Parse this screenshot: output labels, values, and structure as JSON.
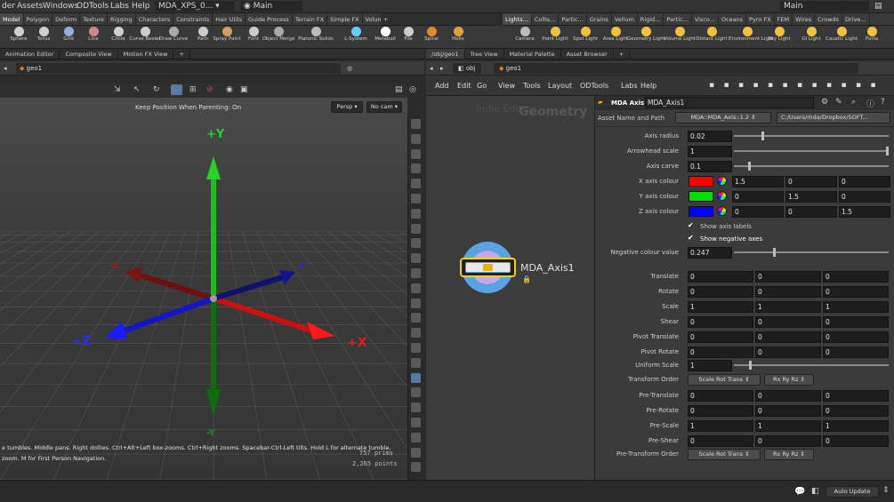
{
  "menubar": {
    "items": [
      "der",
      "Assets",
      "Windows",
      "ODTools",
      "Labs",
      "Help"
    ],
    "desktop": "MDA_XPS_0...",
    "context": "Main",
    "right_context": "Main"
  },
  "shelf_tabs_left": [
    "Model",
    "Polygon",
    "Deform",
    "Texture",
    "Rigging",
    "Characters",
    "Constraints",
    "Hair Utils",
    "Guide Process",
    "Terrain FX",
    "Simple FX",
    "Volume"
  ],
  "shelf_tabs_right": [
    "Lights...",
    "Collis...",
    "Partic...",
    "Grains",
    "Vellum",
    "Rigid...",
    "Partic...",
    "Visco...",
    "Oceans",
    "Pyro FX",
    "FEM",
    "Wires",
    "Crowds",
    "Drive..."
  ],
  "tools_left": [
    "Sphere",
    "Torus",
    "Grid",
    "Line",
    "Circle",
    "Curve Bezier",
    "Draw Curve",
    "Path",
    "Spray Paint",
    "Font",
    "Object Merge",
    "Platonic Solids",
    "L-System",
    "Metaball",
    "File",
    "Spiral",
    "Helix"
  ],
  "tools_right": [
    "Camera",
    "Point Light",
    "Spot Light",
    "Area Light",
    "Geometry Light",
    "Volume Light",
    "Distant Light",
    "Environment Light",
    "Sky Light",
    "GI Light",
    "Caustic Light",
    "Porta"
  ],
  "left_panes": [
    "Animation Editor",
    "Composite View",
    "Motion FX View"
  ],
  "right_panes": [
    "/obj/geo1",
    "Tree View",
    "Material Palette",
    "Asset Browser"
  ],
  "path": {
    "root": "obj",
    "node": "geo1"
  },
  "viewport": {
    "hint": "Keep Position When Parenting: On",
    "persp": "Persp",
    "cam": "No cam",
    "status_line1": "e tumbles. Middle pans. Right dollies. Ctrl+Alt+Left box-zooms. Ctrl+Right zooms. Spacebar-Ctrl-Left tilts. Hold L for alternate tumble,",
    "status_line2": "zoom. M for First Person Navigation.",
    "prims": "757 prims",
    "points": "2,265 points",
    "axis_labels": {
      "py": "+Y",
      "ny": "-Y",
      "px": "+X",
      "nx": "-X",
      "pz": "+Z",
      "nz": "Z"
    }
  },
  "net_menu": [
    "Add",
    "Edit",
    "Go",
    "View",
    "Tools",
    "Layout",
    "ODTools",
    "Labs",
    "Help"
  ],
  "network": {
    "watermark1": "Indie Edition",
    "watermark2": "Geometry",
    "node_name": "MDA_Axis1"
  },
  "parm": {
    "type": "MDA Axis",
    "name": "MDA_Axis1",
    "asset_label": "Asset Name and Path",
    "asset": "MDA::MDA_Axis::1.2",
    "path": "C:/Users/mda/Dropbox/SOFT...",
    "axis_radius_label": "Axis radius",
    "axis_radius": "0.02",
    "arrowhead_label": "Arrowhead scale",
    "arrowhead": "1",
    "carve_label": "Axis carve",
    "carve": "0.1",
    "xcol_label": "X axis colour",
    "xcol": [
      "1.5",
      "0",
      "0"
    ],
    "ycol_label": "Y axis colour",
    "ycol": [
      "0",
      "1.5",
      "0"
    ],
    "zcol_label": "Z axis colour",
    "zcol": [
      "0",
      "0",
      "1.5"
    ],
    "show_labels": "Show axis labels",
    "show_neg": "Show negative axes",
    "neg_label": "Negative colour value",
    "neg": "0.247",
    "translate_label": "Translate",
    "translate": [
      "0",
      "0",
      "0"
    ],
    "rotate_label": "Rotate",
    "rotate": [
      "0",
      "0",
      "0"
    ],
    "scale_label": "Scale",
    "scale": [
      "1",
      "1",
      "1"
    ],
    "shear_label": "Shear",
    "shear": [
      "0",
      "0",
      "0"
    ],
    "pivt_label": "Pivot Translate",
    "pivt": [
      "0",
      "0",
      "0"
    ],
    "pivr_label": "Pivot Rotate",
    "pivr": [
      "0",
      "0",
      "0"
    ],
    "uscale_label": "Uniform Scale",
    "uscale": "1",
    "torder_label": "Transform Order",
    "torder": "Scale Rot Trans",
    "rorder": "Rx Ry Rz",
    "pret_label": "Pre-Translate",
    "pret": [
      "0",
      "0",
      "0"
    ],
    "prer_label": "Pre-Rotate",
    "prer": [
      "0",
      "0",
      "0"
    ],
    "pres_label": "Pre-Scale",
    "pres": [
      "1",
      "1",
      "1"
    ],
    "presh_label": "Pre-Shear",
    "presh": [
      "0",
      "0",
      "0"
    ],
    "ptorder_label": "Pre-Transform Order",
    "ptorder": "Scale Rot Trans",
    "prorder": "Rx Ry Rz"
  },
  "status": {
    "autoupdate": "Auto Update"
  },
  "colors": {
    "x": "#ff0000",
    "y": "#00dd00",
    "z": "#0000ff",
    "node_ring": "#4fa3e0"
  }
}
